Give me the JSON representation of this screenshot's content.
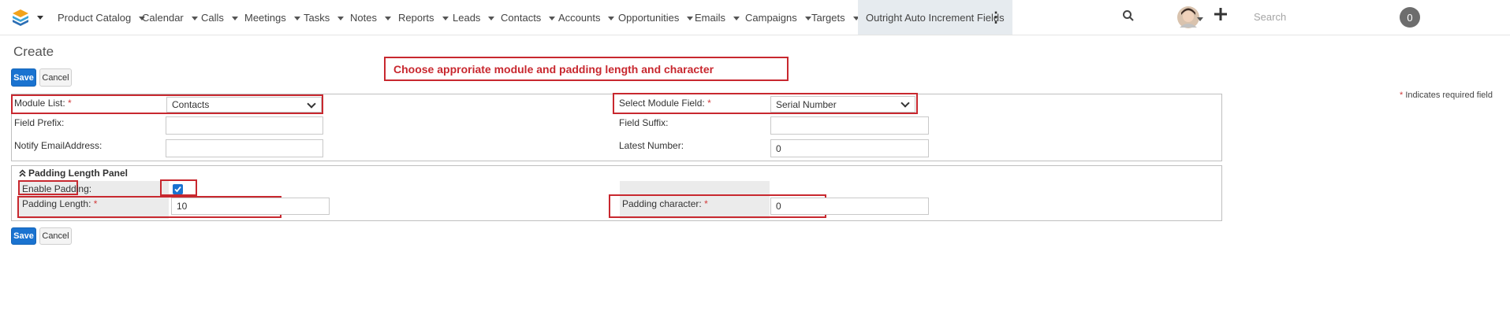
{
  "nav": {
    "items": [
      {
        "label": "Product Catalog"
      },
      {
        "label": "Calendar"
      },
      {
        "label": "Calls"
      },
      {
        "label": "Meetings"
      },
      {
        "label": "Tasks"
      },
      {
        "label": "Notes"
      },
      {
        "label": "Reports"
      },
      {
        "label": "Leads"
      },
      {
        "label": "Contacts"
      },
      {
        "label": "Accounts"
      },
      {
        "label": "Opportunities"
      },
      {
        "label": "Emails"
      },
      {
        "label": "Campaigns"
      },
      {
        "label": "Targets"
      }
    ],
    "active_item": "Outright Auto Increment Fields",
    "search_placeholder": "Search",
    "notification_count": "0"
  },
  "page": {
    "title": "Create",
    "callout": "Choose approriate module and padding length and character",
    "save_label": "Save",
    "cancel_label": "Cancel",
    "required_star": "*",
    "required_note": "Indicates required field"
  },
  "form": {
    "module_list_label": "Module List:",
    "module_list_value": "Contacts",
    "select_module_field_label": "Select Module Field:",
    "select_module_field_value": "Serial Number",
    "field_prefix_label": "Field Prefix:",
    "field_prefix_value": "",
    "field_suffix_label": "Field Suffix:",
    "field_suffix_value": "",
    "notify_email_label": "Notify EmailAddress:",
    "notify_email_value": "",
    "latest_number_label": "Latest Number:",
    "latest_number_value": "0"
  },
  "padding": {
    "panel_title": "Padding Length Panel",
    "enable_label": "Enable Padding:",
    "enable_checked": true,
    "length_label": "Padding Length:",
    "length_value": "10",
    "character_label": "Padding character:",
    "character_value": "0"
  },
  "colors": {
    "primary_button": "#1a73d0",
    "annotation_red": "#c8282f",
    "required_star": "#d23a3a"
  }
}
